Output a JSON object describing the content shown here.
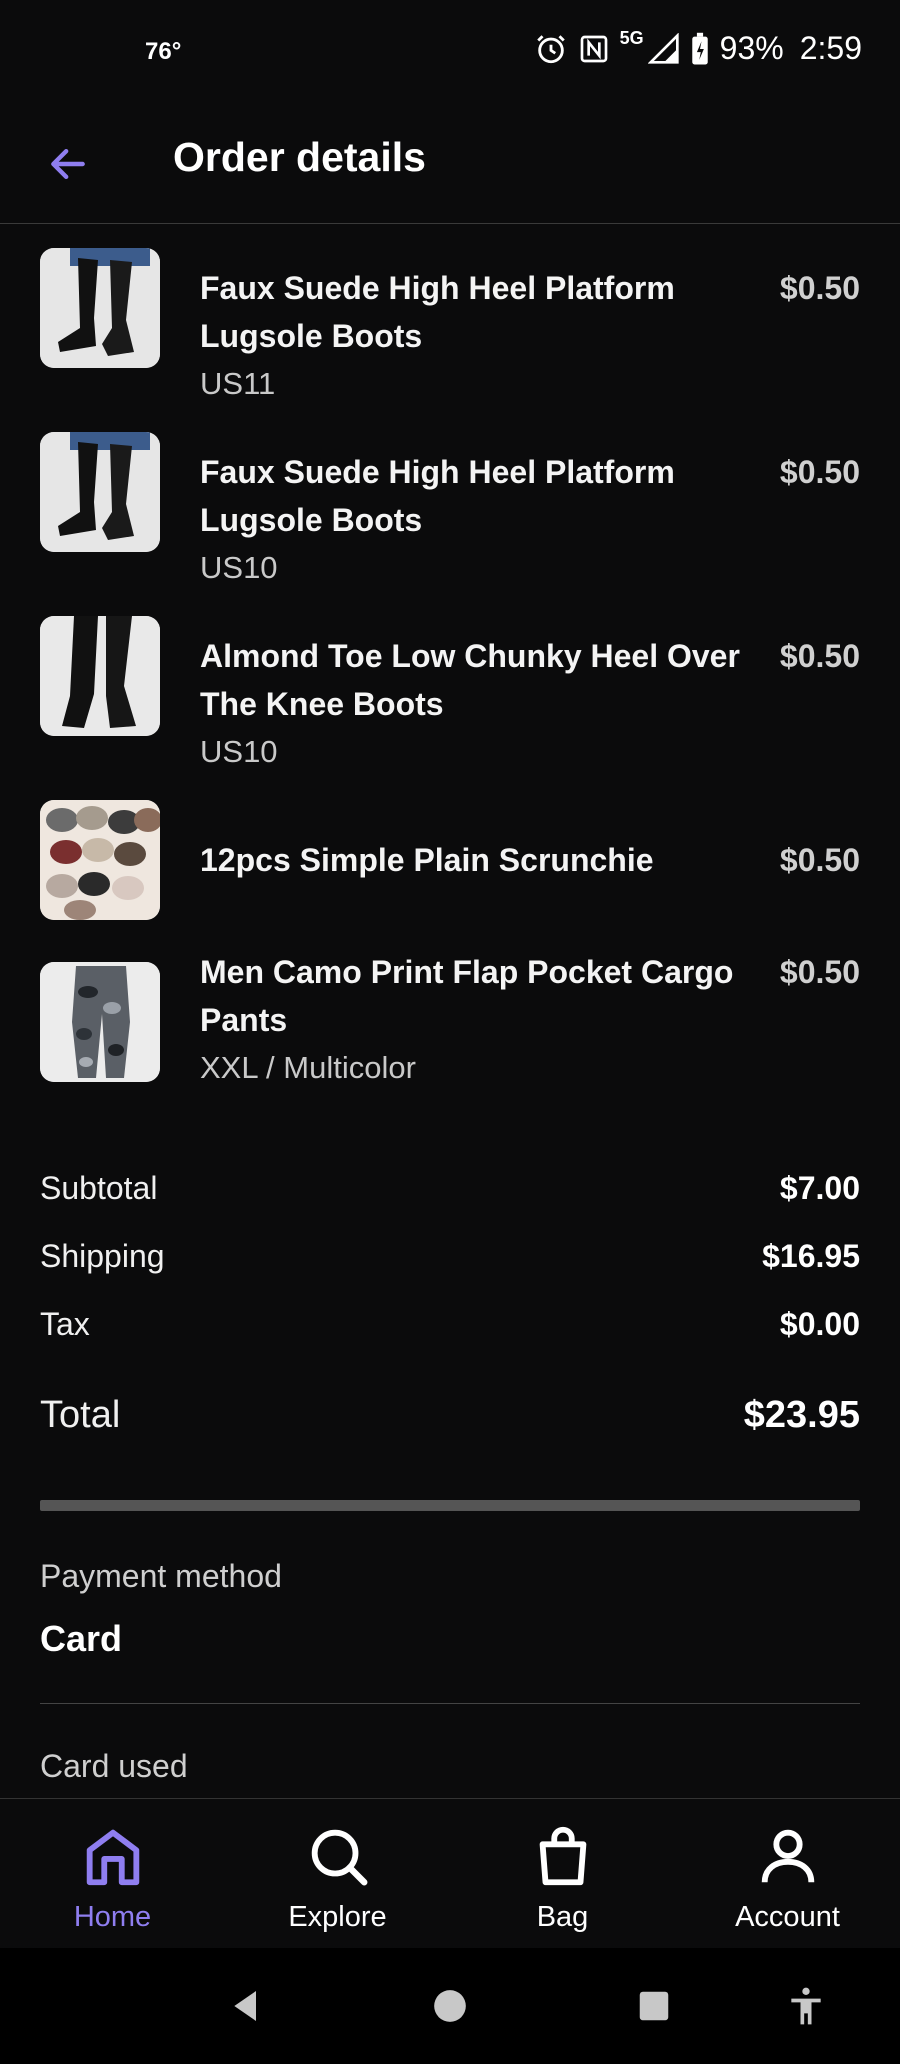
{
  "status_bar": {
    "temperature": "76°",
    "network": "5G",
    "battery": "93%",
    "time": "2:59"
  },
  "header": {
    "title": "Order details"
  },
  "items": [
    {
      "name": "Faux Suede High Heel Platform Lugsole Boots",
      "variant": "US11",
      "price": "$0.50",
      "thumb": "boots"
    },
    {
      "name": "Faux Suede High Heel Platform Lugsole Boots",
      "variant": "US10",
      "price": "$0.50",
      "thumb": "boots"
    },
    {
      "name": "Almond Toe Low Chunky Heel Over The Knee Boots",
      "variant": "US10",
      "price": "$0.50",
      "thumb": "boots2"
    },
    {
      "name": "12pcs Simple Plain Scrunchie",
      "variant": "",
      "price": "$0.50",
      "thumb": "scrunchie"
    },
    {
      "name": "Men Camo Print Flap Pocket Cargo Pants",
      "variant": "XXL / Multicolor",
      "price": "$0.50",
      "thumb": "pants"
    }
  ],
  "totals": {
    "subtotal_label": "Subtotal",
    "subtotal": "$7.00",
    "shipping_label": "Shipping",
    "shipping": "$16.95",
    "tax_label": "Tax",
    "tax": "$0.00",
    "total_label": "Total",
    "total": "$23.95"
  },
  "payment": {
    "method_label": "Payment method",
    "method": "Card",
    "card_used_label": "Card used"
  },
  "bottom_nav": [
    {
      "label": "Home",
      "icon": "home-icon",
      "active": true
    },
    {
      "label": "Explore",
      "icon": "search-icon",
      "active": false
    },
    {
      "label": "Bag",
      "icon": "bag-icon",
      "active": false
    },
    {
      "label": "Account",
      "icon": "account-icon",
      "active": false
    }
  ],
  "colors": {
    "accent": "#8f7ef0",
    "background": "#0b0b0c"
  }
}
